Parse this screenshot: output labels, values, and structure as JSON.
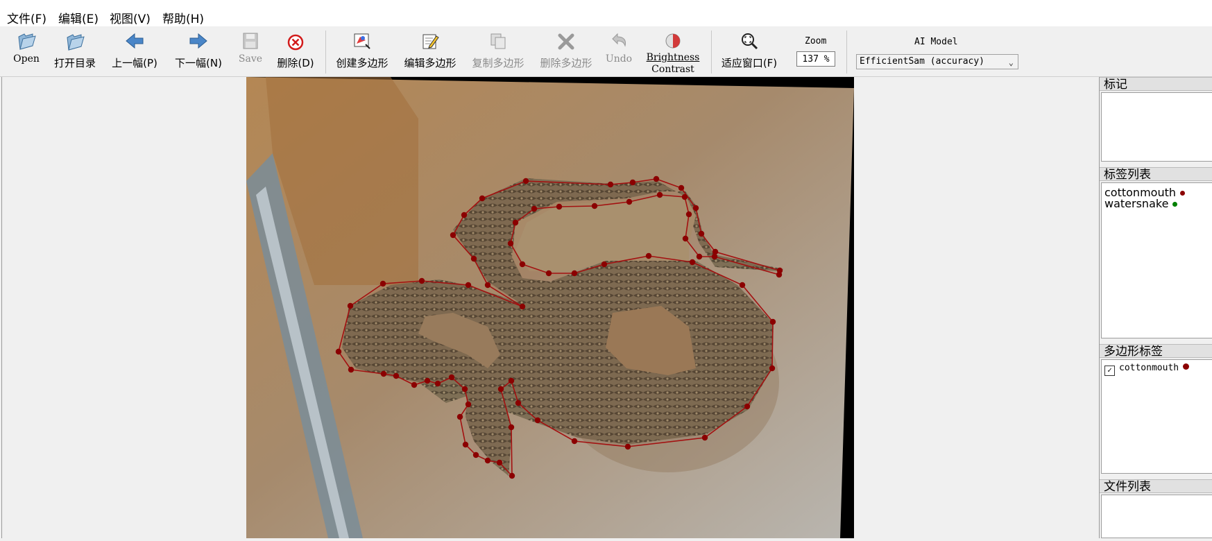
{
  "menu": [
    "文件(F)",
    "编辑(E)",
    "视图(V)",
    "帮助(H)"
  ],
  "toolbar": {
    "open": "Open",
    "open_dir": "打开目录",
    "prev": "上一幅(P)",
    "next": "下一幅(N)",
    "save": "Save",
    "delete": "删除(D)",
    "create_polygon": "创建多边形",
    "edit_polygon": "编辑多边形",
    "copy_polygon": "复制多边形",
    "delete_polygon": "删除多边形",
    "undo": "Undo",
    "brightness": "Brightness",
    "contrast": "Contrast",
    "fit_window": "适应窗口(F)",
    "zoom_label": "Zoom",
    "zoom_value": "137 %",
    "ai_model_label": "AI Model",
    "ai_model_value": "EfficientSam (accuracy)"
  },
  "icons": {
    "open": "folder-open-icon",
    "open_dir": "folder-icon",
    "prev": "arrow-left-icon",
    "next": "arrow-right-icon",
    "save": "floppy-icon",
    "delete": "delete-circle-icon",
    "create_polygon": "polygon-create-icon",
    "edit_polygon": "edit-icon",
    "copy_polygon": "copy-icon",
    "delete_polygon": "x-icon",
    "undo": "undo-icon",
    "brightness": "brightness-icon",
    "fit_window": "zoom-fit-icon",
    "dropdown": "chevron-down-icon"
  },
  "dock": {
    "flags_title": "标记",
    "labels_title": "标签列表",
    "labels": [
      {
        "name": "cottonmouth",
        "color": "#8b0000"
      },
      {
        "name": "watersnake",
        "color": "#008000"
      }
    ],
    "polygons_title": "多边形标签",
    "polygons": [
      {
        "name": "cottonmouth",
        "checked": true,
        "color": "#8b0000"
      }
    ],
    "files_title": "文件列表"
  },
  "annotation_color": "#8b0000"
}
